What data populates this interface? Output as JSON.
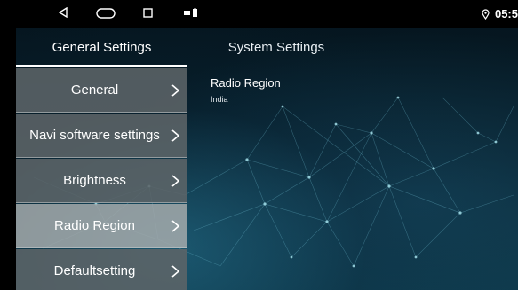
{
  "status": {
    "time": "05:5"
  },
  "tabs": {
    "general": "General Settings",
    "system": "System Settings"
  },
  "menu": {
    "items": [
      {
        "label": "General"
      },
      {
        "label": "Navi software settings"
      },
      {
        "label": "Brightness"
      },
      {
        "label": "Radio Region"
      },
      {
        "label": "Defaultsetting"
      }
    ],
    "selected": "Radio Region"
  },
  "content": {
    "title": "Radio Region",
    "value": "India"
  },
  "colors": {
    "menu_bg": "#5c6468",
    "menu_selected_bg": "#a5aaac",
    "background": "#071f2b",
    "text": "#ffffff"
  },
  "icons": [
    "back-icon",
    "home-icon",
    "recents-icon",
    "notification-icon",
    "battery-icon",
    "location-icon",
    "chevron-right-icon"
  ]
}
